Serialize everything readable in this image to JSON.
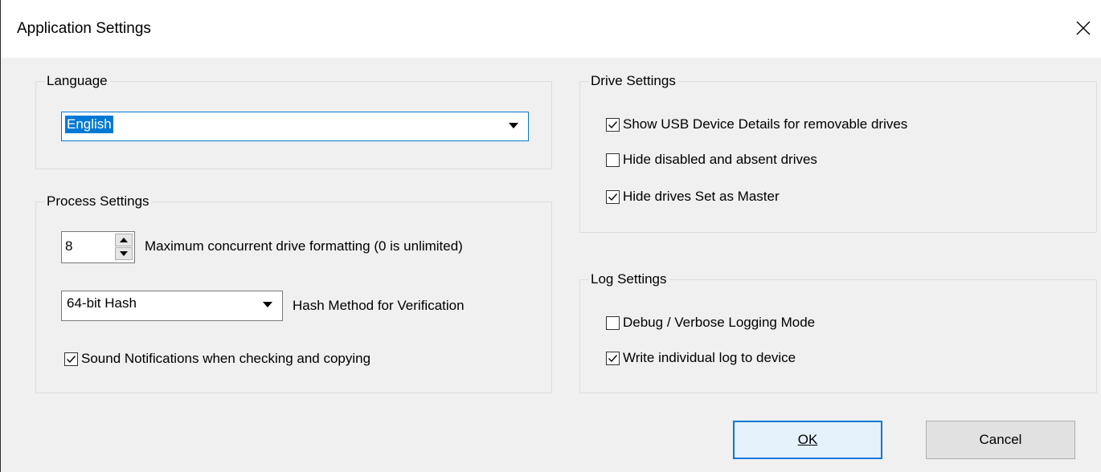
{
  "window": {
    "title": "Application Settings"
  },
  "language": {
    "group_label": "Language",
    "selected": "English"
  },
  "process": {
    "group_label": "Process Settings",
    "max_concurrent_value": "8",
    "max_concurrent_label": "Maximum concurrent drive formatting (0 is unlimited)",
    "hash_selected": "64-bit Hash",
    "hash_label": "Hash Method for Verification",
    "sound_label": "Sound Notifications when checking and copying",
    "sound_checked": true
  },
  "drive": {
    "group_label": "Drive Settings",
    "items": [
      {
        "label": "Show USB Device Details for removable drives",
        "checked": true
      },
      {
        "label": "Hide disabled and absent drives",
        "checked": false
      },
      {
        "label": "Hide drives Set as Master",
        "checked": true
      }
    ]
  },
  "log": {
    "group_label": "Log Settings",
    "items": [
      {
        "label": "Debug / Verbose Logging Mode",
        "checked": false
      },
      {
        "label": "Write individual log to device",
        "checked": true
      }
    ]
  },
  "buttons": {
    "ok": "OK",
    "cancel": "Cancel"
  },
  "colors": {
    "accent": "#0078d7",
    "background": "#f0f0f0"
  }
}
